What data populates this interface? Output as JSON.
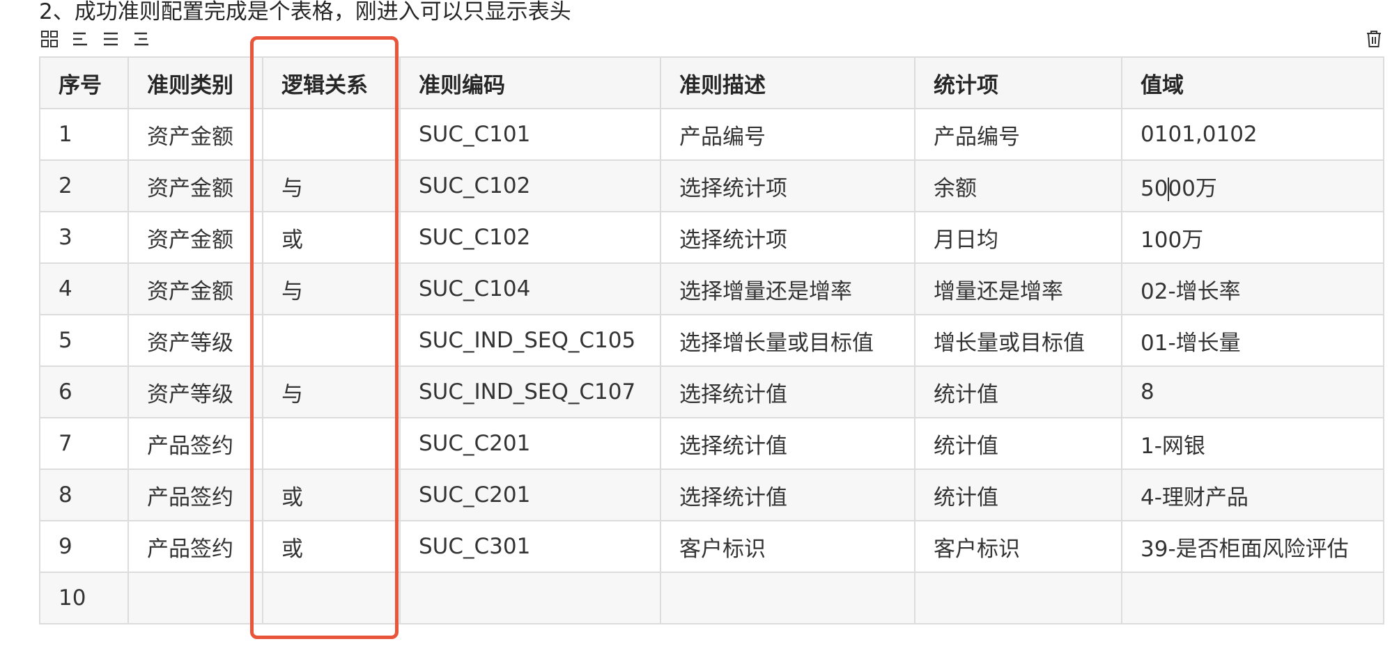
{
  "heading": "2、成功准则配置完成是个表格，刚进入可以只显示表头",
  "toolbar": {
    "icons": [
      "table-layout-icon",
      "align-left-icon",
      "align-center-icon",
      "align-right-icon"
    ],
    "delete_icon": "trash-icon"
  },
  "colors": {
    "highlight": "#e8553a",
    "header_bg": "#f6f6f6",
    "border": "#dcdcdc"
  },
  "table": {
    "columns": [
      "序号",
      "准则类别",
      "逻辑关系",
      "准则编码",
      "准则描述",
      "统计项",
      "值域"
    ],
    "rows": [
      [
        "1",
        "资产金额",
        "",
        "SUC_C101",
        "产品编号",
        "产品编号",
        "0101,0102"
      ],
      [
        "2",
        "资产金额",
        "与",
        "SUC_C102",
        "选择统计项",
        "余额",
        "5000万"
      ],
      [
        "3",
        "资产金额",
        "或",
        "SUC_C102",
        "选择统计项",
        "月日均",
        "100万"
      ],
      [
        "4",
        "资产金额",
        "与",
        "SUC_C104",
        "选择增量还是增率",
        "增量还是增率",
        "02-增长率"
      ],
      [
        "5",
        "资产等级",
        "",
        "SUC_IND_SEQ_C105",
        "选择增长量或目标值",
        "增长量或目标值",
        "01-增长量"
      ],
      [
        "6",
        "资产等级",
        "与",
        "SUC_IND_SEQ_C107",
        "选择统计值",
        "统计值",
        "8"
      ],
      [
        "7",
        "产品签约",
        "",
        "SUC_C201",
        "选择统计值",
        "统计值",
        "1-网银"
      ],
      [
        "8",
        "产品签约",
        "或",
        "SUC_C201",
        "选择统计值",
        "统计值",
        "4-理财产品"
      ],
      [
        "9",
        "产品签约",
        "或",
        "SUC_C301",
        "客户标识",
        "客户标识",
        "39-是否柜面风险评估"
      ],
      [
        "10",
        "",
        "",
        "",
        "",
        "",
        ""
      ]
    ],
    "caret_cell": {
      "row": 1,
      "col": 6,
      "before": "50",
      "after": "00万"
    }
  }
}
